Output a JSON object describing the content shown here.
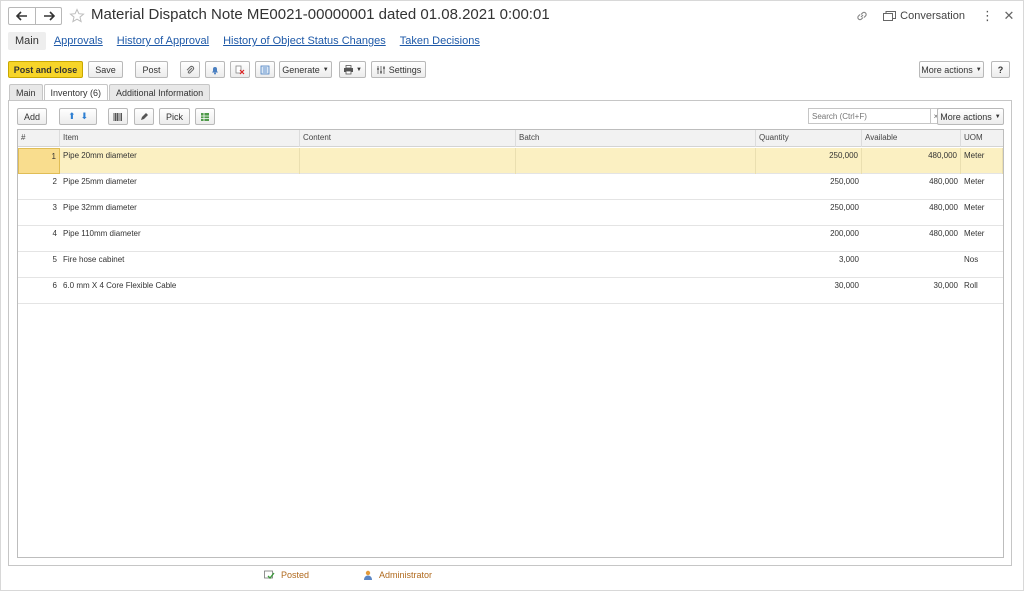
{
  "window": {
    "title": "Material Dispatch Note ME0021-00000001 dated 01.08.2021 0:00:01",
    "conversation_label": "Conversation"
  },
  "sections": [
    {
      "label": "Main",
      "active": true
    },
    {
      "label": "Approvals"
    },
    {
      "label": "History of Approval"
    },
    {
      "label": "History of Object Status Changes"
    },
    {
      "label": "Taken Decisions"
    }
  ],
  "toolbar": {
    "post_close": "Post and close",
    "save": "Save",
    "post": "Post",
    "generate": "Generate",
    "settings": "Settings",
    "more_actions": "More actions",
    "help": "?"
  },
  "form_tabs": [
    {
      "label": "Main"
    },
    {
      "label": "Inventory (6)",
      "active": true
    },
    {
      "label": "Additional Information"
    }
  ],
  "table_toolbar": {
    "add": "Add",
    "pick": "Pick",
    "search_placeholder": "Search (Ctrl+F)",
    "clear": "×",
    "more_actions": "More actions"
  },
  "table": {
    "columns": [
      "#",
      "Item",
      "Content",
      "Batch",
      "Quantity",
      "Available",
      "UOM"
    ],
    "rows": [
      {
        "n": "1",
        "item": "Pipe 20mm diameter",
        "content": "",
        "batch": "",
        "quantity": "250,000",
        "available": "480,000",
        "uom": "Meter"
      },
      {
        "n": "2",
        "item": "Pipe 25mm diameter",
        "content": "",
        "batch": "",
        "quantity": "250,000",
        "available": "480,000",
        "uom": "Meter"
      },
      {
        "n": "3",
        "item": "Pipe 32mm diameter",
        "content": "",
        "batch": "",
        "quantity": "250,000",
        "available": "480,000",
        "uom": "Meter"
      },
      {
        "n": "4",
        "item": "Pipe 110mm diameter",
        "content": "",
        "batch": "",
        "quantity": "200,000",
        "available": "480,000",
        "uom": "Meter"
      },
      {
        "n": "5",
        "item": "Fire hose cabinet",
        "content": "",
        "batch": "",
        "quantity": "3,000",
        "available": "",
        "uom": "Nos"
      },
      {
        "n": "6",
        "item": "6.0 mm X 4 Core Flexible Cable",
        "content": "",
        "batch": "",
        "quantity": "30,000",
        "available": "30,000",
        "uom": "Roll"
      }
    ]
  },
  "footer": {
    "status": "Posted",
    "user": "Administrator"
  },
  "colors": {
    "accent_button": "#f7d529",
    "link": "#1e59a8",
    "selected_row": "#fbf0c2",
    "footer_text": "#b06a1e"
  }
}
